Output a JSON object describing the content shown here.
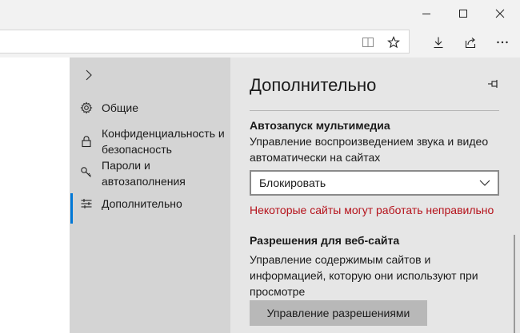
{
  "window": {
    "controls": [
      "minimize",
      "maximize",
      "close"
    ]
  },
  "toolbar": {
    "icons": [
      "reading-view-icon",
      "favorite-star-icon",
      "downloads-icon",
      "share-icon",
      "more-icon"
    ]
  },
  "nav": {
    "items": [
      {
        "label": "Общие",
        "icon": "gear-icon"
      },
      {
        "label": "Конфиденциальность и безопасность",
        "icon": "lock-icon"
      },
      {
        "label": "Пароли и автозаполнения",
        "icon": "key-icon"
      },
      {
        "label": "Дополнительно",
        "icon": "sliders-icon",
        "active": true
      }
    ]
  },
  "panel": {
    "title": "Дополнительно",
    "autoplay": {
      "heading": "Автозапуск мультимедиа",
      "description": "Управление воспроизведением звука и видео автоматически на сайтах",
      "selected": "Блокировать",
      "warning": "Некоторые сайты могут работать неправильно"
    },
    "permissions": {
      "heading": "Разрешения для веб-сайта",
      "description": "Управление содержимым сайтов и информацией, которую они используют при просмотре",
      "button": "Управление разрешениями"
    }
  }
}
